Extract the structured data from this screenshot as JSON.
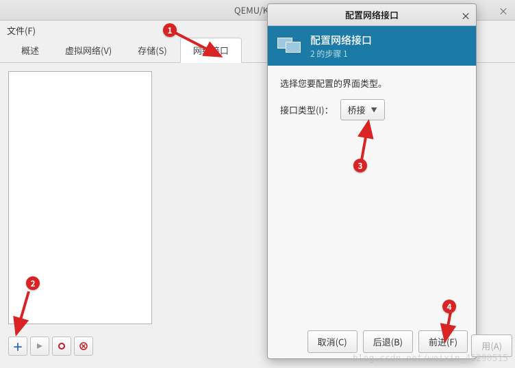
{
  "main_window": {
    "title": "QEMU/KVM",
    "menu": {
      "file": "文件(F)"
    },
    "tabs": [
      {
        "label": "概述"
      },
      {
        "label": "虚拟网络(V)"
      },
      {
        "label": "存储(S)"
      },
      {
        "label": "网络接口",
        "active": true
      }
    ],
    "hidden_apply_btn": "用(A)"
  },
  "dialog": {
    "title": "配置网络接口",
    "header_title": "配置网络接口",
    "header_subtitle": "2 的步骤 1",
    "body_prompt": "选择您要配置的界面类型。",
    "type_label": "接口类型(I)：",
    "type_value": "桥接",
    "buttons": {
      "cancel": "取消(C)",
      "back": "后退(B)",
      "forward": "前进(F)"
    }
  },
  "annotations": {
    "b1": "1",
    "b2": "2",
    "b3": "3",
    "b4": "4"
  },
  "watermark": "blog.csdn.net/weixin_45290515"
}
